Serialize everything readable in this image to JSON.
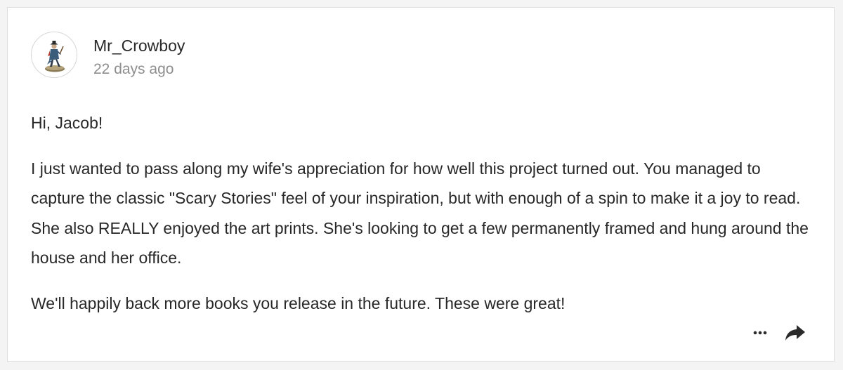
{
  "comment": {
    "author": "Mr_Crowboy",
    "time_ago": "22 days ago",
    "greeting": "Hi, Jacob!",
    "paragraph_1": "I just wanted to pass along my wife's appreciation for how well this project turned out. You managed to capture the classic \"Scary Stories\" feel of your inspiration, but with enough of a spin to make it a joy to read. She also REALLY enjoyed the art prints. She's looking to get a few permanently framed and hung around the house and her office.",
    "paragraph_2": "We'll happily back more books you release in the future. These were great!"
  },
  "actions": {
    "more_icon": "more-horizontal-icon",
    "share_icon": "share-icon"
  },
  "colors": {
    "text": "#282828",
    "muted": "#8e8e8e",
    "border": "#dddddd",
    "background": "#f4f4f4"
  }
}
